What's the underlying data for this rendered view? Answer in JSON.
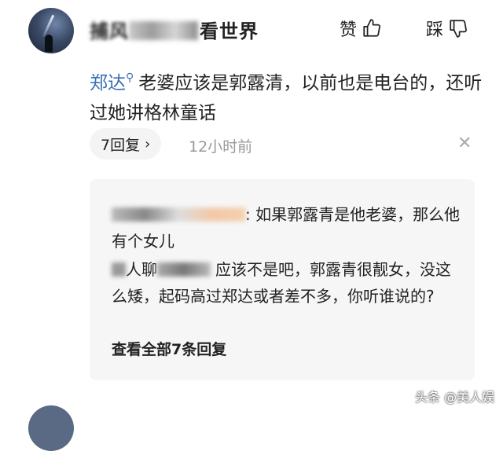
{
  "comment": {
    "username_visible": "看世界",
    "username_prefix": "捕风",
    "like_label": "赞",
    "dislike_label": "踩",
    "mention": "郑达",
    "text": "老婆应该是郭露清，以前也是电台的，还听过她讲格林童话",
    "reply_count_label": "7回复",
    "time": "12小时前"
  },
  "replies": [
    {
      "text": ": 如果郭露青是他老婆，那么他有个女儿"
    },
    {
      "name_visible": "人聊",
      "text": "应该不是吧，郭露青很靓女，没这么矮，起码高过郑达或者差不多，你听谁说的?"
    }
  ],
  "see_all_label": "查看全部7条回复",
  "watermark": "头条 @美人娱",
  "icons": {
    "like": "thumb-up-icon",
    "dislike": "thumb-down-icon",
    "close": "close-icon",
    "chevron": "chevron-right-icon",
    "search": "search-icon"
  },
  "colors": {
    "mention": "#3b6fb5",
    "muted": "#999999"
  }
}
